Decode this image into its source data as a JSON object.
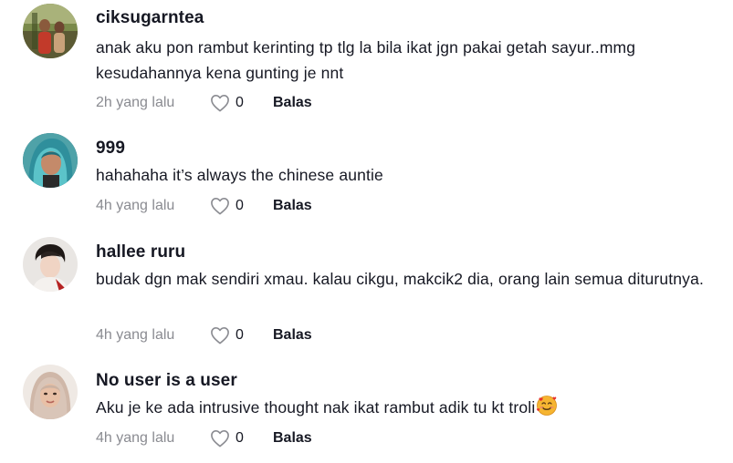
{
  "comments": [
    {
      "username": "ciksugarntea",
      "text": "anak aku pon rambut kerinting tp tlg la bila ikat jgn pakai getah sayur..mmg kesudahannya kena gunting je nnt",
      "time": "2h yang lalu",
      "likes": "0",
      "reply_label": "Balas",
      "avatar": "profile-photo"
    },
    {
      "username": "999",
      "text": "hahahaha it’s always the chinese auntie",
      "time": "4h yang lalu",
      "likes": "0",
      "reply_label": "Balas",
      "avatar": "profile-photo"
    },
    {
      "username": "hallee ruru",
      "text": "budak dgn mak sendiri xmau. kalau cikgu, makcik2 dia, orang lain semua diturutnya.",
      "time": "4h yang lalu",
      "likes": "0",
      "reply_label": "Balas",
      "avatar": "profile-photo"
    },
    {
      "username": "No user is a user",
      "text": "Aku je ke ada intrusive thought nak ikat rambut adik tu kt troli",
      "text_emoji": "smiling-face-with-hearts",
      "time": "4h yang lalu",
      "likes": "0",
      "reply_label": "Balas",
      "avatar": "profile-photo"
    }
  ],
  "icons": {
    "like": "heart-outline-icon"
  },
  "colors": {
    "text": "#161823",
    "muted": "#8a8b91",
    "background": "#ffffff"
  }
}
